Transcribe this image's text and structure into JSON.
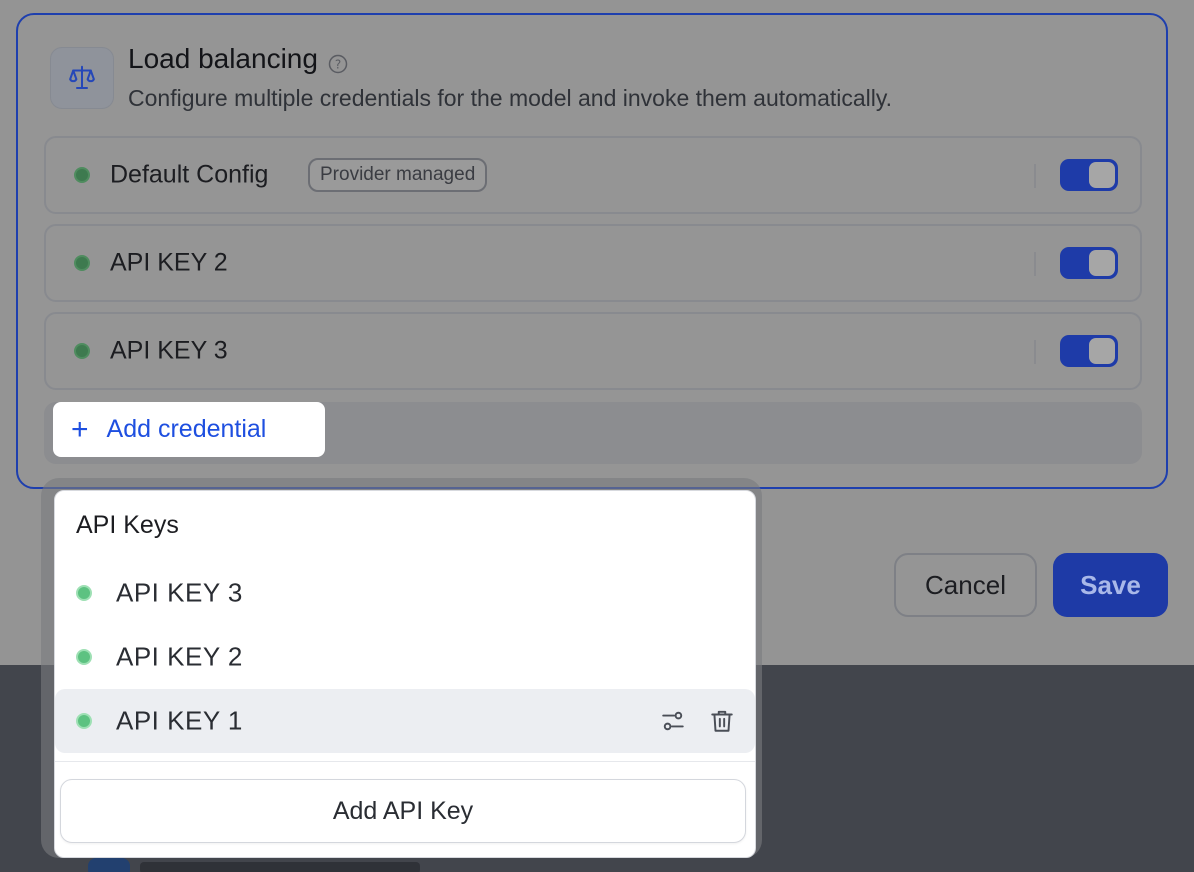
{
  "load_balancing": {
    "title": "Load balancing",
    "description": "Configure multiple credentials for the model and invoke them automatically.",
    "configs": [
      {
        "label": "Default Config",
        "badge": "Provider managed",
        "enabled": true
      },
      {
        "label": "API KEY 2",
        "enabled": true
      },
      {
        "label": "API KEY 3",
        "enabled": true
      }
    ],
    "add_credential_label": "Add credential"
  },
  "footer": {
    "cancel_label": "Cancel",
    "save_label": "Save"
  },
  "api_keys_dropdown": {
    "title": "API Keys",
    "items": [
      {
        "label": "API KEY 3"
      },
      {
        "label": "API KEY 2"
      },
      {
        "label": "API KEY 1",
        "hovered": true,
        "actions": [
          "settings-icon",
          "trash-icon"
        ]
      }
    ],
    "add_label": "Add API Key"
  },
  "colors": {
    "accent": "#1e4fe0",
    "toggle_on": "#1e3ba8",
    "status_ok": "#5dc281"
  }
}
